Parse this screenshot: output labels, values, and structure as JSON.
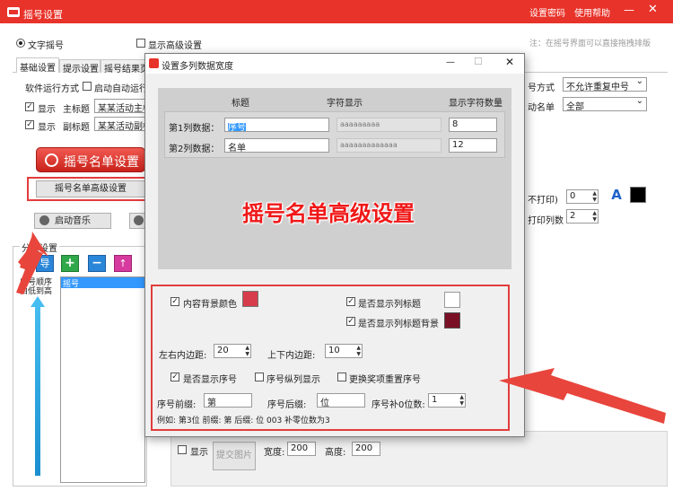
{
  "window": {
    "title": "摇号设置",
    "link_password": "设置密码",
    "link_help": "使用帮助",
    "min_glyph": "—",
    "close_glyph": "✕"
  },
  "options": {
    "radio_text_lottery": "文字摇号",
    "show_advanced": "显示高级设置",
    "note": "注：在摇号界面可以直接拖拽排版"
  },
  "tabs": [
    "基础设置",
    "提示设置",
    "摇号结果页"
  ],
  "left": {
    "run_mode_label": "软件运行方式",
    "auto_run_label": "启动自动运行",
    "show_label": "显示",
    "main_title_label": "主标题",
    "main_title_value": "某某活动主标",
    "sub_title_label": "副标题",
    "sub_title_value": "某某活动副标",
    "big_button": "摇号名单设置",
    "adv_button": "摇号名单高级设置",
    "music_button": "启动音乐",
    "category_label": "分类设置",
    "order_label": "序号顺序由低到高",
    "list_item": "摇号"
  },
  "right": {
    "mode_label": "号方式",
    "mode_value": "不允许重复中号",
    "list_label": "动名单",
    "list_value": "全部",
    "noprint_label": "不打印)",
    "noprint_value": "0",
    "print_cols_label": "打印列数",
    "print_cols_value": "2",
    "font_glyph": "A"
  },
  "bottom": {
    "show_label": "显示",
    "upload_label": "提交图片",
    "width_label": "宽度:",
    "width_value": "200",
    "height_label": "高度:",
    "height_value": "200"
  },
  "dialog": {
    "title": "设置多列数据宽度",
    "min_glyph": "—",
    "max_glyph": "☐",
    "close_glyph": "✕",
    "col_title": "标题",
    "col_char": "字符显示",
    "col_count": "显示字符数量",
    "rows": [
      {
        "label": "第1列数据：",
        "title": "序号",
        "chars": "aaaaaaaaa",
        "count": "8"
      },
      {
        "label": "第2列数据：",
        "title": "名单",
        "chars": "aaaaaaaaaaaaa",
        "count": "12"
      }
    ],
    "overlay_text": "摇号名单高级设置",
    "bg_color_label": "内容背景颜色",
    "show_col_title": "是否显示列标题",
    "show_col_title_bg": "是否显示列标题背景",
    "lr_padding_label": "左右内边距:",
    "lr_padding_value": "20",
    "tb_padding_label": "上下内边距:",
    "tb_padding_value": "10",
    "show_index": "是否显示序号",
    "index_vertical": "序号纵列显示",
    "reset_index": "更换奖项重置序号",
    "prefix_label": "序号前缀:",
    "prefix_value": "第",
    "suffix_label": "序号后缀:",
    "suffix_value": "位",
    "pad_label": "序号补0位数:",
    "pad_value": "1",
    "example": "例如: 第3位      前缀: 第      后缀: 位      003  补零位数为3"
  },
  "colors": {
    "titlebar": "#e8332a",
    "swatch_content_bg": "#d63c4c",
    "swatch_title_bg": "#7a1025",
    "highlight": "#e23c3c",
    "overlay_text": "#f01818"
  }
}
